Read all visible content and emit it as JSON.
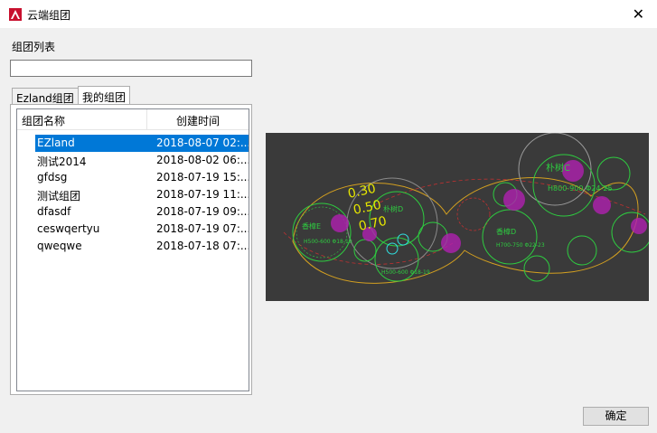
{
  "window": {
    "title": "云端组团"
  },
  "labels": {
    "group_list": "组团列表"
  },
  "search": {
    "value": ""
  },
  "tabs": [
    {
      "label": "Ezland组团",
      "active": false
    },
    {
      "label": "我的组团",
      "active": true
    }
  ],
  "table": {
    "columns": [
      "组团名称",
      "创建时间"
    ],
    "rows": [
      {
        "name": "EZland",
        "time": "2018-08-07 02:...",
        "selected": true
      },
      {
        "name": "测试2014",
        "time": "2018-08-02 06:..."
      },
      {
        "name": "gfdsg",
        "time": "2018-07-19 15:..."
      },
      {
        "name": "测试组团",
        "time": "2018-07-19 11:..."
      },
      {
        "name": "dfasdf",
        "time": "2018-07-19 09:..."
      },
      {
        "name": "ceswqertyu",
        "time": "2018-07-19 07:..."
      },
      {
        "name": "qweqwe",
        "time": "2018-07-18 07:..."
      }
    ]
  },
  "preview": {
    "dims": [
      "0.30",
      "0.50",
      "0.70"
    ],
    "tree_labels": [
      "香樟E",
      "朴树D",
      "朴树C",
      "香樟D"
    ],
    "specs": [
      "H500-600\nΦ18-19",
      "H500-600\nΦ18-19",
      "H700-750\nΦ22-23",
      "H800-900\nΦ24-25"
    ]
  },
  "buttons": {
    "ok": "确定"
  },
  "colors": {
    "selection": "#0078d7",
    "preview_bg": "#3a3a3a",
    "tree_green": "#2ecc40",
    "dim_yellow": "#e6e600",
    "magenta": "#c020c0"
  }
}
